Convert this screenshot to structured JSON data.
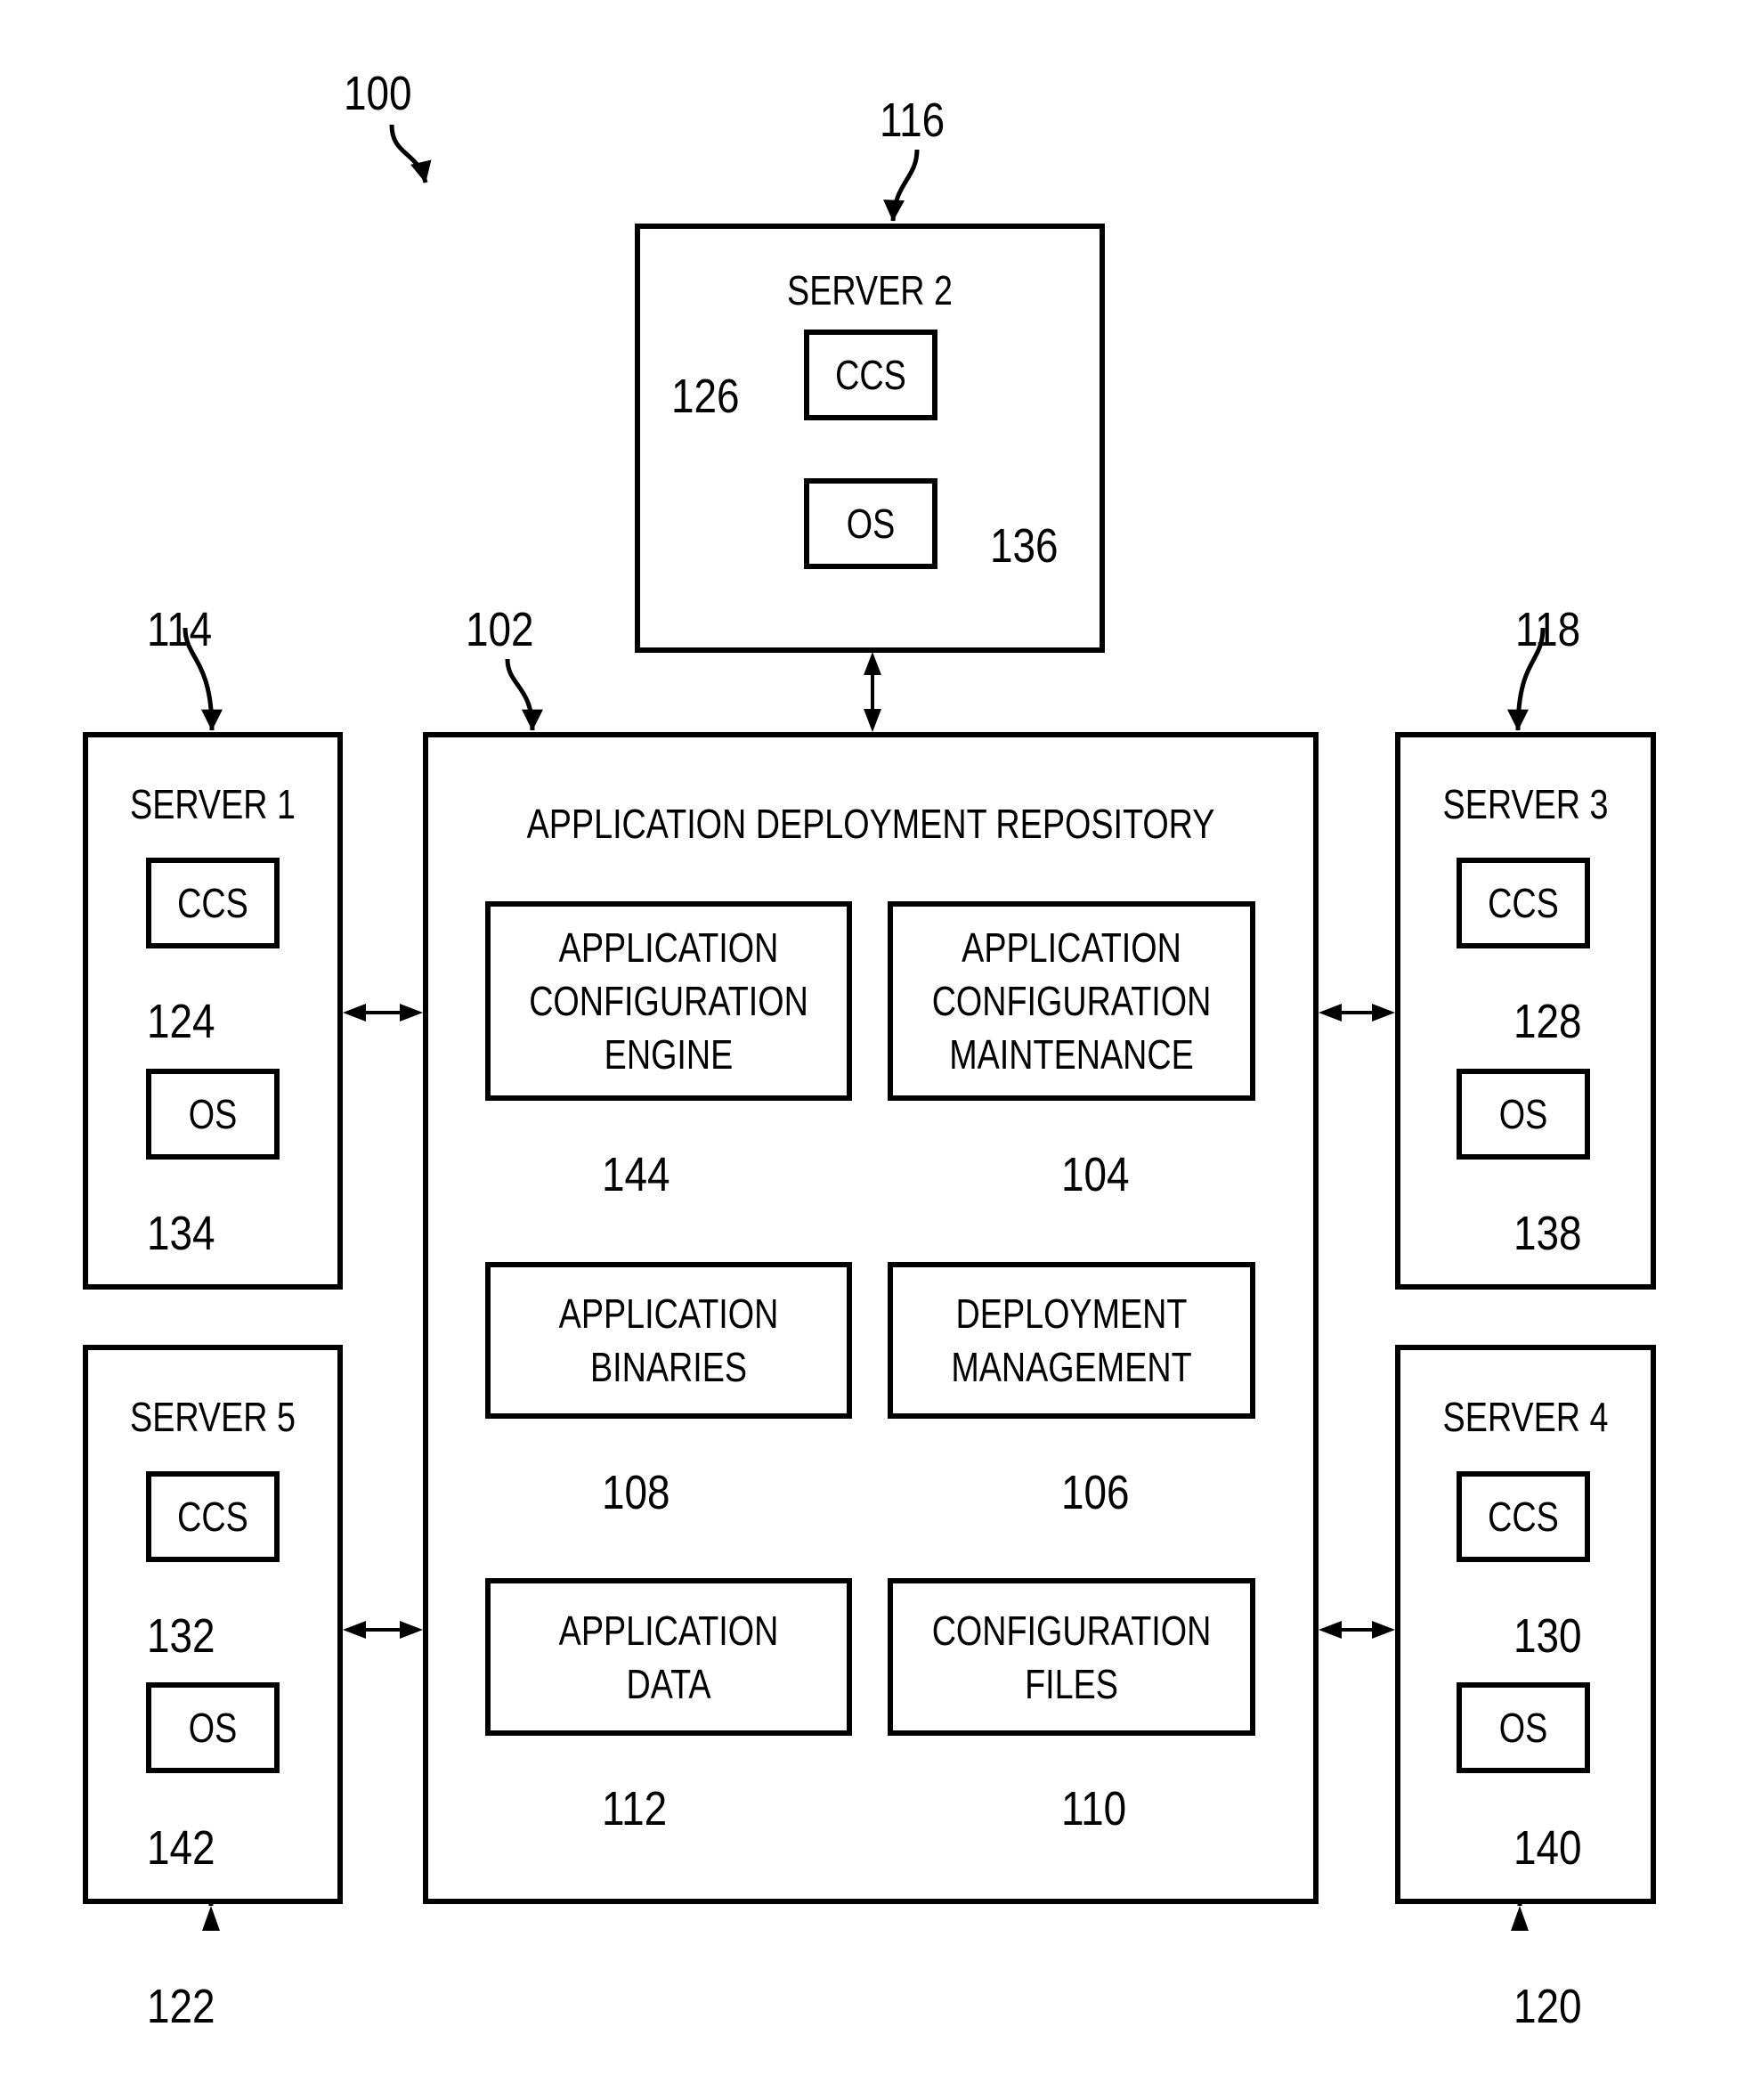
{
  "figure": {
    "ref": "100"
  },
  "repository": {
    "ref": "102",
    "title": "APPLICATION DEPLOYMENT REPOSITORY",
    "components": [
      {
        "ref": "144",
        "label": "APPLICATION\nCONFIGURATION\nENGINE"
      },
      {
        "ref": "104",
        "label": "APPLICATION\nCONFIGURATION\nMAINTENANCE"
      },
      {
        "ref": "108",
        "label": "APPLICATION\nBINARIES"
      },
      {
        "ref": "106",
        "label": "DEPLOYMENT\nMANAGEMENT"
      },
      {
        "ref": "112",
        "label": "APPLICATION\nDATA"
      },
      {
        "ref": "110",
        "label": "CONFIGURATION\nFILES"
      }
    ]
  },
  "servers": {
    "server1": {
      "ref": "114",
      "title": "SERVER 1",
      "ccs": {
        "label": "CCS",
        "ref": "124"
      },
      "os": {
        "label": "OS",
        "ref": "134"
      }
    },
    "server2": {
      "ref": "116",
      "title": "SERVER 2",
      "ccs": {
        "label": "CCS",
        "ref": "126"
      },
      "os": {
        "label": "OS",
        "ref": "136"
      }
    },
    "server3": {
      "ref": "118",
      "title": "SERVER 3",
      "ccs": {
        "label": "CCS",
        "ref": "128"
      },
      "os": {
        "label": "OS",
        "ref": "138"
      }
    },
    "server4": {
      "ref": "120",
      "title": "SERVER 4",
      "ccs": {
        "label": "CCS",
        "ref": "130"
      },
      "os": {
        "label": "OS",
        "ref": "140"
      }
    },
    "server5": {
      "ref": "122",
      "title": "SERVER 5",
      "ccs": {
        "label": "CCS",
        "ref": "132"
      },
      "os": {
        "label": "OS",
        "ref": "142"
      }
    }
  }
}
